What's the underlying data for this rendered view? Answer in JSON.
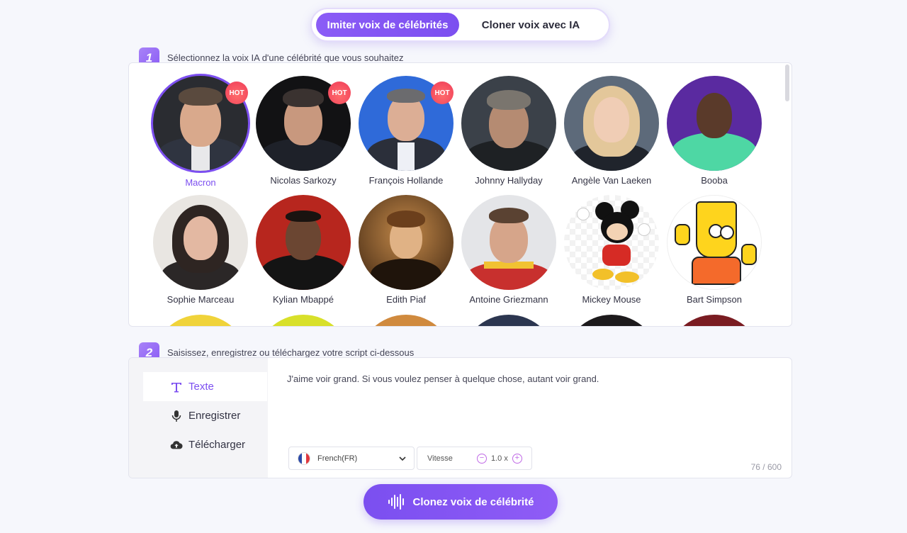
{
  "tabs": {
    "active": "Imiter voix de célébrités",
    "inactive": "Cloner voix avec IA"
  },
  "step1": {
    "num": "1",
    "text": "Sélectionnez la voix IA d'une célébrité que vous souhaitez"
  },
  "step2": {
    "num": "2",
    "text": "Saisissez, enregistrez ou téléchargez votre script ci-dessous"
  },
  "hot_label": "HOT",
  "celebrities": [
    {
      "name": "Macron",
      "hot": true,
      "selected": true
    },
    {
      "name": "Nicolas Sarkozy",
      "hot": true
    },
    {
      "name": "François Hollande",
      "hot": true
    },
    {
      "name": "Johnny Hallyday"
    },
    {
      "name": "Angèle Van Laeken"
    },
    {
      "name": "Booba"
    },
    {
      "name": "Sophie Marceau"
    },
    {
      "name": "Kylian Mbappé"
    },
    {
      "name": "Edith Piaf"
    },
    {
      "name": "Antoine Griezmann"
    },
    {
      "name": "Mickey Mouse"
    },
    {
      "name": "Bart Simpson"
    }
  ],
  "side_menu": {
    "text": "Texte",
    "record": "Enregistrer",
    "upload": "Télécharger"
  },
  "script": {
    "text": "J'aime voir grand. Si vous voulez penser à quelque chose, autant voir grand.",
    "language": "French(FR)",
    "speed_label": "Vitesse",
    "speed_value": "1.0 x",
    "counter": "76 / 600"
  },
  "cta": "Clonez voix de célébrité",
  "colors": {
    "accent": "#7c4ff0",
    "hot": "#ef3d59"
  }
}
